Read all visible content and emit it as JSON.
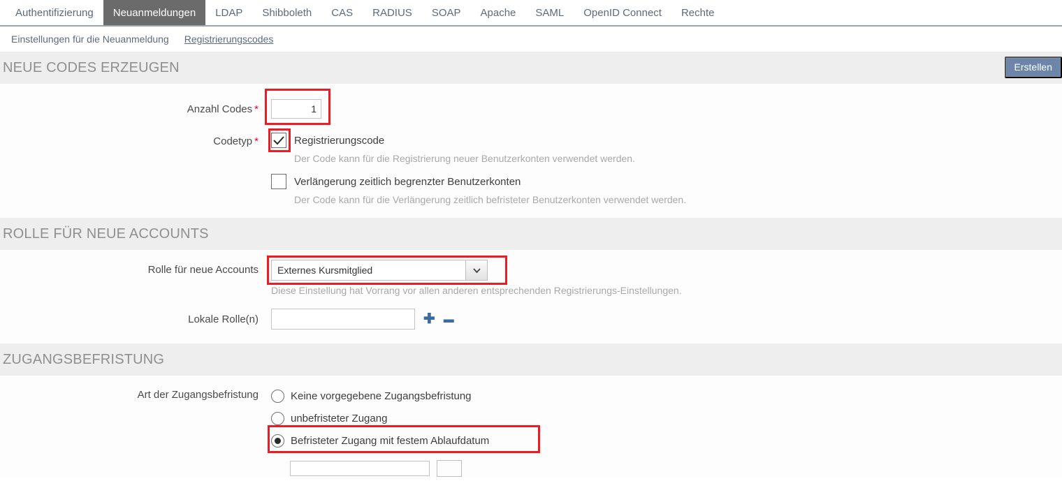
{
  "tabs": [
    {
      "label": "Authentifizierung",
      "active": false
    },
    {
      "label": "Neuanmeldungen",
      "active": true
    },
    {
      "label": "LDAP",
      "active": false
    },
    {
      "label": "Shibboleth",
      "active": false
    },
    {
      "label": "CAS",
      "active": false
    },
    {
      "label": "RADIUS",
      "active": false
    },
    {
      "label": "SOAP",
      "active": false
    },
    {
      "label": "Apache",
      "active": false
    },
    {
      "label": "SAML",
      "active": false
    },
    {
      "label": "OpenID Connect",
      "active": false
    },
    {
      "label": "Rechte",
      "active": false
    }
  ],
  "subnav": [
    {
      "label": "Einstellungen für die Neuanmeldung",
      "active": false
    },
    {
      "label": "Registrierungscodes",
      "active": true
    }
  ],
  "sections": {
    "generate": {
      "title": "NEUE CODES ERZEUGEN",
      "create_button": "Erstellen",
      "count_label": "Anzahl Codes",
      "count_value": "1",
      "codetype_label": "Codetyp",
      "checkbox_registration": {
        "label": "Registrierungscode",
        "hint": "Der Code kann für die Registrierung neuer Benutzerkonten verwendet werden.",
        "checked": true
      },
      "checkbox_extension": {
        "label": "Verlängerung zeitlich begrenzter Benutzerkonten",
        "hint": "Der Code kann für die Verlängerung zeitlich befristeter Benutzerkonten verwendet werden.",
        "checked": false
      }
    },
    "role": {
      "title": "ROLLE FÜR NEUE ACCOUNTS",
      "role_label": "Rolle für neue Accounts",
      "role_value": "Externes Kursmitglied",
      "role_hint": "Diese Einstellung hat Vorrang vor allen anderen entsprechenden Registrierungs-Einstellungen.",
      "local_role_label": "Lokale Rolle(n)",
      "local_role_value": "",
      "add_symbol": "✚",
      "remove_symbol": "▬"
    },
    "access": {
      "title": "ZUGANGSBEFRISTUNG",
      "type_label": "Art der Zugangsbefristung",
      "options": [
        {
          "label": "Keine vorgegebene Zugangsbefristung",
          "selected": false
        },
        {
          "label": "unbefristeter Zugang",
          "selected": false
        },
        {
          "label": "Befristeter Zugang mit festem Ablaufdatum",
          "selected": true
        }
      ],
      "date_value": ""
    }
  },
  "colors": {
    "accent": "#6d85a8",
    "highlight": "#ed1c24",
    "required": "#e4002b",
    "active_tab_bg": "#6b6b6b",
    "section_bg": "#eeeeee",
    "link": "#5b6b7d"
  }
}
